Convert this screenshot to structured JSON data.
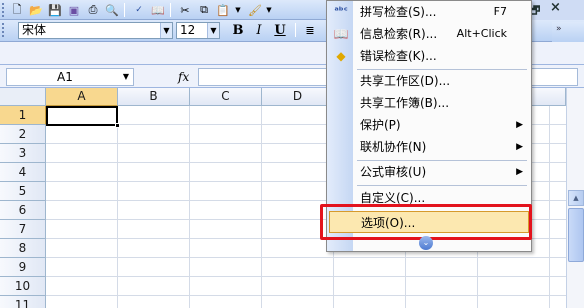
{
  "standard_toolbar": {
    "buttons": [
      "new-icon",
      "open-icon",
      "save-icon",
      "permission-icon",
      "print-icon",
      "print-preview-icon",
      "spelling-icon",
      "research-icon",
      "cut-icon",
      "copy-icon",
      "paste-icon",
      "format-painter-icon"
    ]
  },
  "format_toolbar": {
    "font_name": "宋体",
    "font_size": "12",
    "bold_label": "B",
    "italic_label": "I",
    "underline_label": "U"
  },
  "formula_bar": {
    "name_box": "A1",
    "fx_label": "fx",
    "formula": ""
  },
  "grid": {
    "columns": [
      "A",
      "B",
      "C",
      "D"
    ],
    "rows": [
      "1",
      "2",
      "3",
      "4",
      "5",
      "6",
      "7",
      "8",
      "9",
      "10",
      "11"
    ],
    "active_cell": "A1"
  },
  "window_controls": {
    "restore": "🗗",
    "close": "×"
  },
  "tools_menu": {
    "items": [
      {
        "label": "拼写检查(S)...",
        "shortcut": "F7",
        "icon": "spelling-icon"
      },
      {
        "label": "信息检索(R)...",
        "shortcut": "Alt+Click",
        "icon": "research-icon"
      },
      {
        "label": "错误检查(K)...",
        "shortcut": "",
        "icon": "error-check-icon"
      },
      {
        "label": "共享工作区(D)...",
        "shortcut": ""
      },
      {
        "label": "共享工作簿(B)...",
        "shortcut": ""
      },
      {
        "label": "保护(P)",
        "shortcut": "",
        "submenu": true
      },
      {
        "label": "联机协作(N)",
        "shortcut": "",
        "submenu": true
      },
      {
        "label": "公式审核(U)",
        "shortcut": "",
        "submenu": true
      },
      {
        "label": "自定义(C)...",
        "shortcut": ""
      },
      {
        "label": "选项(O)...",
        "shortcut": "",
        "highlighted": true
      }
    ],
    "submenu_arrow": "▶",
    "expand_glyph": "⌄"
  },
  "colors": {
    "highlight_border": "#e3131d",
    "menu_hover": "#fce8b0",
    "toolbar_blue": "#b9d1f3"
  }
}
